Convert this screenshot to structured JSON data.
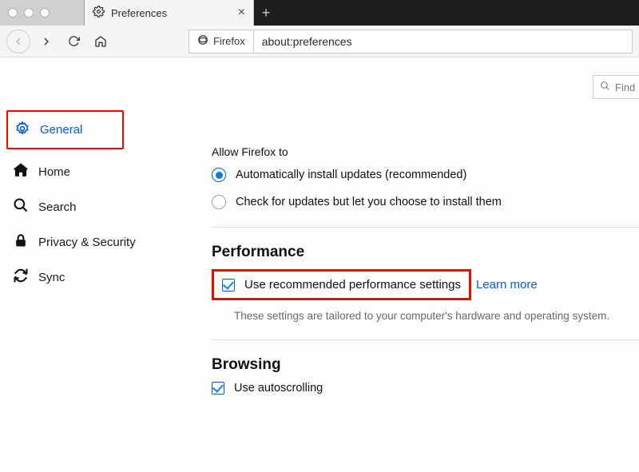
{
  "tab": {
    "title": "Preferences"
  },
  "identity": {
    "label": "Firefox"
  },
  "url": {
    "value": "about:preferences"
  },
  "find": {
    "placeholder": "Find"
  },
  "sidebar": {
    "items": [
      {
        "label": "General"
      },
      {
        "label": "Home"
      },
      {
        "label": "Search"
      },
      {
        "label": "Privacy & Security"
      },
      {
        "label": "Sync"
      }
    ]
  },
  "updates": {
    "allow_label": "Allow Firefox to",
    "auto_label": "Automatically install updates (recommended)",
    "check_label": "Check for updates but let you choose to install them"
  },
  "performance": {
    "heading": "Performance",
    "recommended_label": "Use recommended performance settings",
    "learn_more": "Learn more",
    "note": "These settings are tailored to your computer's hardware and operating system."
  },
  "browsing": {
    "heading": "Browsing",
    "autoscroll_label": "Use autoscrolling"
  }
}
